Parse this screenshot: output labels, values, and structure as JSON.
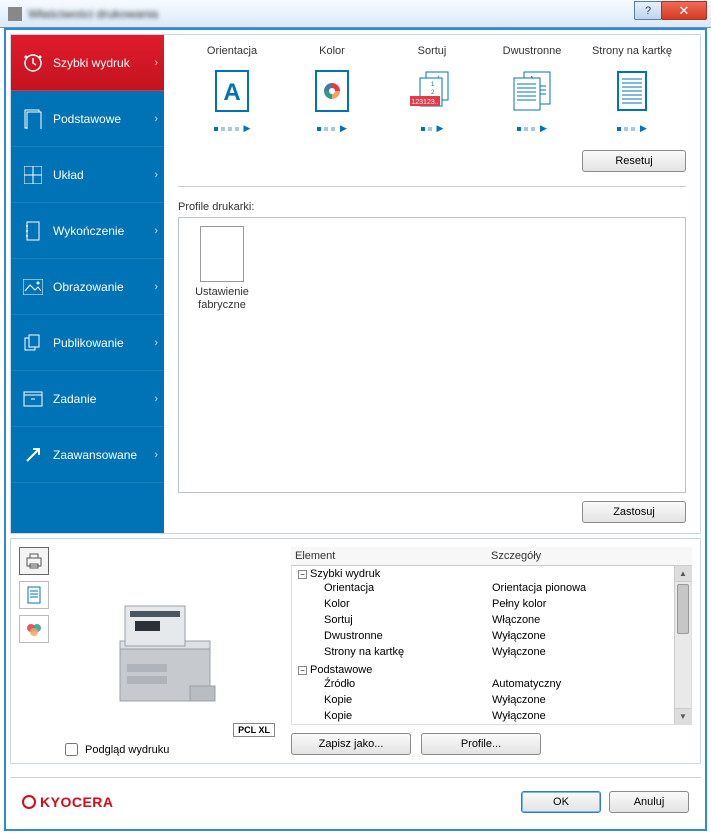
{
  "titlebar": {
    "title": "Właściwości drukowania"
  },
  "sidebar": {
    "items": [
      {
        "label": "Szybki wydruk",
        "icon": "clock"
      },
      {
        "label": "Podstawowe",
        "icon": "page"
      },
      {
        "label": "Układ",
        "icon": "grid"
      },
      {
        "label": "Wykończenie",
        "icon": "binder"
      },
      {
        "label": "Obrazowanie",
        "icon": "image"
      },
      {
        "label": "Publikowanie",
        "icon": "pages"
      },
      {
        "label": "Zadanie",
        "icon": "box"
      },
      {
        "label": "Zaawansowane",
        "icon": "arrow"
      }
    ]
  },
  "options": {
    "items": [
      {
        "label": "Orientacja"
      },
      {
        "label": "Kolor"
      },
      {
        "label": "Sortuj"
      },
      {
        "label": "Dwustronne"
      },
      {
        "label": "Strony na kartkę"
      }
    ],
    "reset": "Resetuj"
  },
  "profiles": {
    "label": "Profile drukarki:",
    "item": "Ustawienie fabryczne",
    "apply": "Zastosuj"
  },
  "preview": {
    "pcl_badge": "PCL XL",
    "checkbox": "Podgląd wydruku"
  },
  "details": {
    "col_element": "Element",
    "col_details": "Szczegóły",
    "groups": [
      {
        "name": "Szybki wydruk",
        "rows": [
          {
            "k": "Orientacja",
            "v": "Orientacja pionowa"
          },
          {
            "k": "Kolor",
            "v": "Pełny kolor"
          },
          {
            "k": "Sortuj",
            "v": "Włączone"
          },
          {
            "k": "Dwustronne",
            "v": "Wyłączone"
          },
          {
            "k": "Strony na kartkę",
            "v": "Wyłączone"
          }
        ]
      },
      {
        "name": "Podstawowe",
        "rows": [
          {
            "k": "Źródło",
            "v": "Automatyczny"
          },
          {
            "k": "Kopie",
            "v": "Wyłączone"
          },
          {
            "k": "Kopie",
            "v": "Wyłączone"
          }
        ]
      }
    ],
    "save_as": "Zapisz jako...",
    "profiles_btn": "Profile..."
  },
  "footer": {
    "brand": "KYOCERA",
    "ok": "OK",
    "cancel": "Anuluj"
  }
}
